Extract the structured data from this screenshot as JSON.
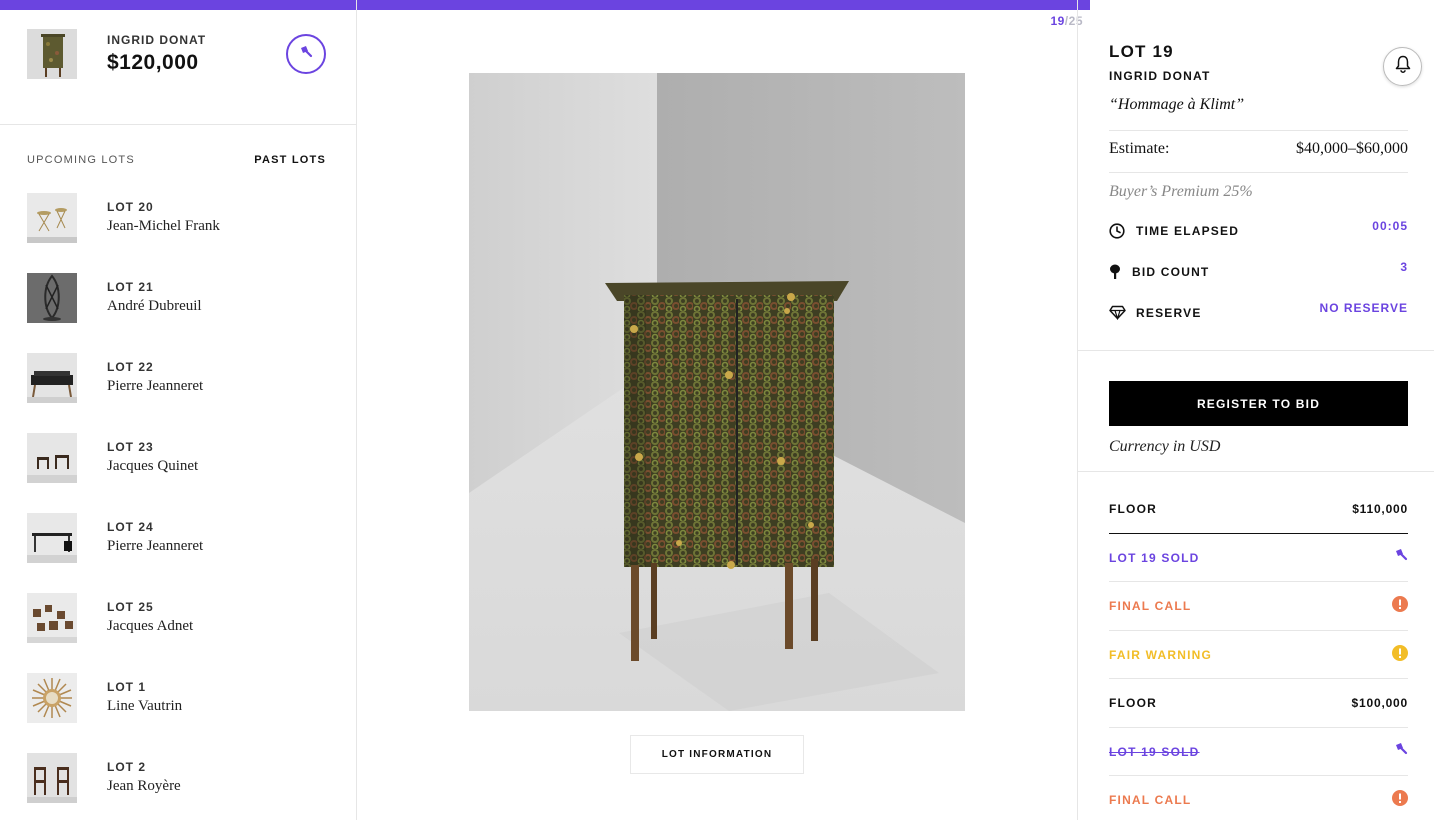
{
  "progress": {
    "current": "19",
    "separator": "/",
    "total": "25",
    "fraction": 0.76
  },
  "current_lot": {
    "artist": "INGRID DONAT",
    "price": "$120,000"
  },
  "tabs": {
    "upcoming": "UPCOMING LOTS",
    "past": "PAST LOTS"
  },
  "upcoming_lots": [
    {
      "lot": "LOT 20",
      "artist": "Jean-Michel Frank"
    },
    {
      "lot": "LOT 21",
      "artist": "André Dubreuil"
    },
    {
      "lot": "LOT 22",
      "artist": "Pierre Jeanneret"
    },
    {
      "lot": "LOT 23",
      "artist": "Jacques Quinet"
    },
    {
      "lot": "LOT 24",
      "artist": "Pierre Jeanneret"
    },
    {
      "lot": "LOT 25",
      "artist": "Jacques Adnet"
    },
    {
      "lot": "LOT 1",
      "artist": "Line Vautrin"
    },
    {
      "lot": "LOT 2",
      "artist": "Jean Royère"
    }
  ],
  "lot_info_button": "LOT INFORMATION",
  "details": {
    "lot": "LOT 19",
    "artist": "INGRID DONAT",
    "title": "“Hommage à Klimt”",
    "estimate_label": "Estimate:",
    "estimate_value": "$40,000–$60,000",
    "premium": "Buyer’s Premium 25%",
    "time_label": "TIME ELAPSED",
    "time_value": "00:05",
    "bids_label": "BID COUNT",
    "bids_value": "3",
    "reserve_label": "RESERVE",
    "reserve_value": "NO RESERVE",
    "register": "REGISTER TO BID",
    "currency": "Currency in USD"
  },
  "feed": [
    {
      "type": "floor",
      "label": "FLOOR",
      "value": "$110,000"
    },
    {
      "type": "sold",
      "label": "LOT 19 SOLD"
    },
    {
      "type": "final",
      "label": "FINAL CALL"
    },
    {
      "type": "fair",
      "label": "FAIR WARNING"
    },
    {
      "type": "floor",
      "label": "FLOOR",
      "value": "$100,000"
    },
    {
      "type": "sold-struck",
      "label": "LOT 19 SOLD"
    },
    {
      "type": "final",
      "label": "FINAL CALL"
    }
  ],
  "colors": {
    "accent": "#6b44e0",
    "orange": "#ec7a4f",
    "yellow": "#f2bd27"
  },
  "icons": [
    "gavel-icon",
    "bell-icon",
    "clock-icon",
    "paddle-icon",
    "diamond-icon",
    "alert-icon"
  ]
}
